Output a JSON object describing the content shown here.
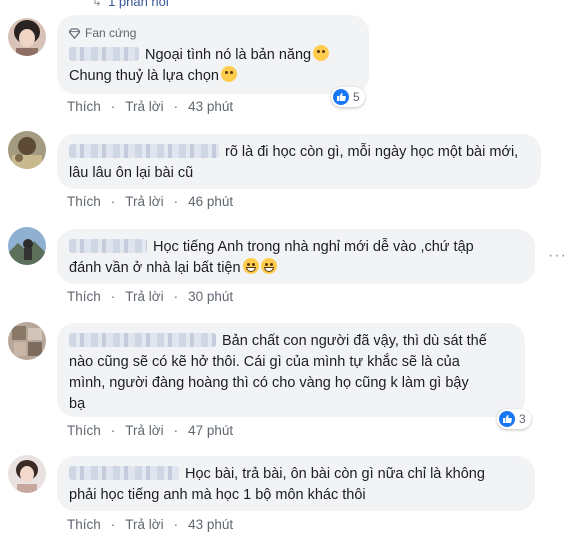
{
  "top_reply": {
    "icon": "reply-arrow-icon",
    "label": "1 phản hồi"
  },
  "comments": [
    {
      "badge": "Fan cứng",
      "lines": [
        "Ngoại tình nó là bản năng",
        "Chung thuỷ là lựa chọn"
      ],
      "like": "Thích",
      "reply": "Trả lời",
      "time": "43 phút",
      "reactions": "5"
    },
    {
      "lines": [
        "rõ là đi học còn gì, mỗi ngày học một bài mới,",
        "lâu lâu ôn lại bài cũ"
      ],
      "like": "Thích",
      "reply": "Trả lời",
      "time": "46 phút"
    },
    {
      "lines": [
        "Học tiếng Anh trong nhà nghỉ mới dễ vào ,chứ tập",
        "đánh vần ở nhà lại bất tiện"
      ],
      "like": "Thích",
      "reply": "Trả lời",
      "time": "30 phút"
    },
    {
      "lines": [
        "Bản chất con người đã vậy, thì dù sát thế",
        "nào cũng sẽ có kẽ hở thôi. Cái gì của mình tự khắc sẽ là của",
        "mình, người đàng hoàng thì có cho vàng họ cũng k làm gì bậy",
        "bạ"
      ],
      "like": "Thích",
      "reply": "Trả lời",
      "time": "47 phút",
      "reactions": "3"
    },
    {
      "lines": [
        "Học bài, trả bài, ôn bài còn gì nữa chỉ là không",
        "phải học tiếng anh mà học 1 bộ môn khác thôi"
      ],
      "like": "Thích",
      "reply": "Trả lời",
      "time": "43 phút"
    }
  ],
  "colors": {
    "bubble": "#f2f3f5",
    "like_blue": "#1877f2",
    "meta_gray": "#606770"
  }
}
